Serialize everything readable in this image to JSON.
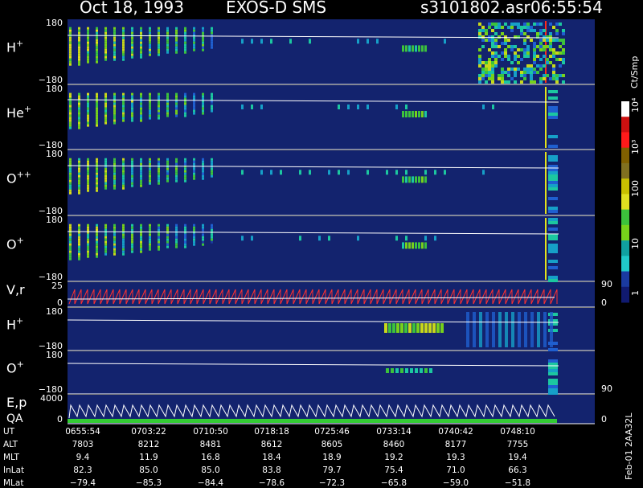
{
  "header": {
    "date": "Oct 18, 1993",
    "instrument": "EXOS-D SMS",
    "file": "s3101802.asr",
    "time": "06:55:54"
  },
  "chart_data": {
    "type": "heatmap",
    "panels": [
      {
        "id": "h-plus",
        "label_main": "H",
        "label_sup": "+",
        "ymax": "180",
        "ymin": "−180"
      },
      {
        "id": "he-plus",
        "label_main": "He",
        "label_sup": "+",
        "ymax": "180",
        "ymin": "−180"
      },
      {
        "id": "o-plusplus",
        "label_main": "O",
        "label_sup": "++",
        "ymax": "180",
        "ymin": "−180"
      },
      {
        "id": "o-plus",
        "label_main": "O",
        "label_sup": "+",
        "ymax": "180",
        "ymin": "−180"
      },
      {
        "id": "vr",
        "label_main": "V,r",
        "label_sup": "",
        "ymax": "25",
        "ymin": "0",
        "right_top": "90",
        "right_bottom": "0"
      },
      {
        "id": "h-plus-2",
        "label_main": "H",
        "label_sup": "+",
        "ymax": "180",
        "ymin": "−180"
      },
      {
        "id": "o-plus-2",
        "label_main": "O",
        "label_sup": "+",
        "ymax": "180",
        "ymin": "−180",
        "right_top": "90"
      },
      {
        "id": "ep-qa",
        "label_main": "E,p",
        "label_sup": "",
        "label_sub": "QA",
        "ymax": "4000",
        "ymin": "0",
        "right_bottom": "0"
      }
    ],
    "colorbar": {
      "title": "Ct/Smp",
      "ticks": [
        "10⁴",
        "10³",
        "100",
        "10",
        "1"
      ]
    },
    "time_axis": {
      "rows": [
        {
          "label": "UT",
          "values": [
            "0655:54",
            "0703:22",
            "0710:50",
            "0718:18",
            "0725:46",
            "0733:14",
            "0740:42",
            "0748:10"
          ]
        },
        {
          "label": "ALT",
          "values": [
            "7803",
            "8212",
            "8481",
            "8612",
            "8605",
            "8460",
            "8177",
            "7755"
          ]
        },
        {
          "label": "MLT",
          "values": [
            "9.4",
            "11.9",
            "16.8",
            "18.4",
            "18.9",
            "19.2",
            "19.3",
            "19.4"
          ]
        },
        {
          "label": "InLat",
          "values": [
            "82.3",
            "85.0",
            "85.0",
            "83.8",
            "79.7",
            "75.4",
            "71.0",
            "66.3"
          ]
        },
        {
          "label": "MLat",
          "values": [
            "−79.4",
            "−85.3",
            "−84.4",
            "−78.6",
            "−72.3",
            "−65.8",
            "−59.0",
            "−51.8"
          ]
        }
      ]
    },
    "footer_note": "Feb-01 2AA32L",
    "colors": {
      "background": "#000000",
      "field": "#13236e",
      "text": "#ffffff"
    }
  }
}
